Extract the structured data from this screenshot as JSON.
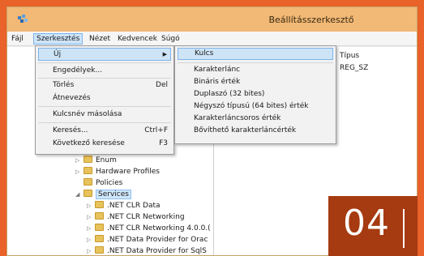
{
  "window": {
    "title": "Beállításszerkesztő",
    "app_icon": "registry-editor-icon"
  },
  "menubar": {
    "items": [
      "Fájl",
      "Szerkesztés",
      "Nézet",
      "Kedvencek",
      "Súgó"
    ],
    "active": "Szerkesztés"
  },
  "edit_menu": {
    "items": [
      {
        "label": "Új",
        "shortcut": "",
        "submenu": true
      },
      {
        "label": "Engedélyek...",
        "shortcut": ""
      },
      {
        "label": "Törlés",
        "shortcut": "Del"
      },
      {
        "label": "Átnevezés",
        "shortcut": ""
      },
      {
        "label": "Kulcsnév másolása",
        "shortcut": ""
      },
      {
        "label": "Keresés...",
        "shortcut": "Ctrl+F"
      },
      {
        "label": "Következő keresése",
        "shortcut": "F3"
      }
    ]
  },
  "new_submenu": {
    "items": [
      "Kulcs",
      "Karakterlánc",
      "Bináris érték",
      "Duplaszó (32 bites)",
      "Négyszó típusú (64 bites) érték",
      "Karakterláncsoros érték",
      "Bővíthető karakterláncérték"
    ]
  },
  "values_pane": {
    "type_header": "Típus",
    "type_value": "REG_SZ"
  },
  "tree": {
    "items": [
      {
        "label": "Enum",
        "expanded": false
      },
      {
        "label": "Hardware Profiles",
        "expanded": false
      },
      {
        "label": "Policies",
        "expanded": false
      },
      {
        "label": "Services",
        "expanded": true
      },
      {
        "label": ".NET CLR Data",
        "expanded": false
      },
      {
        "label": ".NET CLR Networking",
        "expanded": false
      },
      {
        "label": ".NET CLR Networking 4.0.0.(",
        "expanded": false
      },
      {
        "label": ".NET Data Provider for Orac",
        "expanded": false
      },
      {
        "label": ".NET Data Provider for SqlS",
        "expanded": false
      }
    ]
  },
  "badge": {
    "text": "04"
  },
  "colors": {
    "background": "#e8622a",
    "titlebar": "#f1b876",
    "highlight": "#cde4f7",
    "badge": "#a63a10"
  }
}
